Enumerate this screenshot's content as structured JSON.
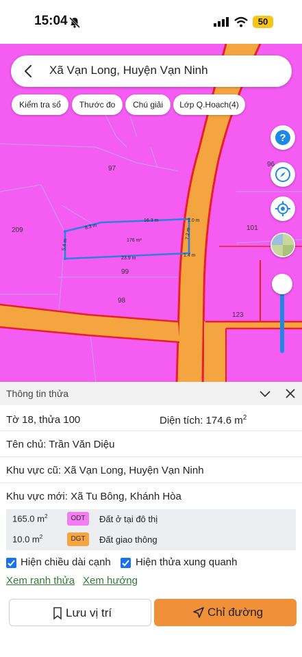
{
  "status": {
    "time": "15:04",
    "battery": "50"
  },
  "search": {
    "text": "Xã Vạn Long, Huyện Vạn Ninh"
  },
  "chips": [
    {
      "label": "Kiểm tra sổ"
    },
    {
      "label": "Thước đo"
    },
    {
      "label": "Chú giải"
    },
    {
      "label": "Lớp Q.Hoạch(4)"
    }
  ],
  "map": {
    "parcels": [
      "97",
      "209",
      "99",
      "98",
      "101",
      "123",
      "96"
    ],
    "edges": [
      "16.3 m",
      "8.3 m",
      "1.0 m",
      "5.4 m",
      "7.2 m",
      "23.9 m",
      "1.4 m"
    ],
    "area_label": "176 m²",
    "colors": {
      "residential": "#f45cf2",
      "road": "#f5a540",
      "boundary": "#2d7fe0",
      "road_edge": "#e8202a"
    }
  },
  "panel": {
    "title": "Thông tin thửa",
    "sheet_plot": "Tờ 18, thửa 100",
    "area_label": "Diện tích: 174.6 m",
    "area_sup": "2",
    "owner": "Tên chủ: Trần Văn Diệu",
    "old_region": "Khu vực cũ: Xã Vạn Long, Huyện Vạn Ninh",
    "new_region": "Khu vực mới: Xã Tu Bông, Khánh Hòa",
    "uses": [
      {
        "area": "165.0 m",
        "sup": "2",
        "code": "ODT",
        "name": "Đất ở tại đô thị",
        "color": "#f27cf0"
      },
      {
        "area": "10.0 m",
        "sup": "2",
        "code": "DGT",
        "name": "Đất giao thông",
        "color": "#f5a540"
      }
    ],
    "checkbox_edges": "Hiện chiều dài cạnh",
    "checkbox_neighbors": "Hiện thửa xung quanh",
    "link_boundary": "Xem ranh thửa",
    "link_direction": "Xem hướng",
    "btn_save": "Lưu vị trí",
    "btn_direction": "Chỉ đường"
  }
}
